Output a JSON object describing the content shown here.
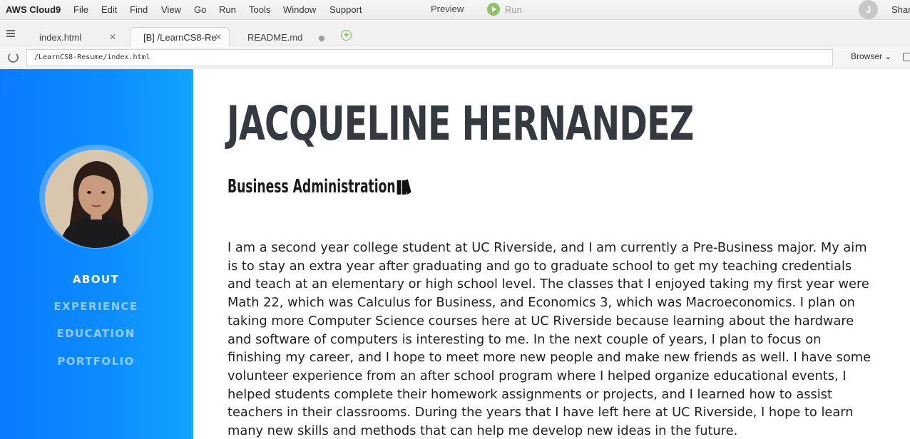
{
  "menubar": {
    "brand": "AWS Cloud9",
    "items": [
      "File",
      "Edit",
      "Find",
      "View",
      "Go",
      "Run",
      "Tools",
      "Window",
      "Support"
    ],
    "preview": "Preview",
    "run": "Run",
    "user_initial": "J",
    "user_name": "Shar"
  },
  "tabs": [
    {
      "label": "index.html",
      "state": "close"
    },
    {
      "label": "[B] /LearnCS8-Re",
      "state": "close"
    },
    {
      "label": "README.md",
      "state": "unsaved"
    }
  ],
  "address_bar": {
    "url": "/LearnCS8-Resume/index.html",
    "browser_select": "Browser"
  },
  "colors": {
    "sidebar_start": "#0a7bff",
    "sidebar_end": "#12a4ff",
    "heading": "#343a40",
    "run_green": "#8fc26a"
  },
  "page": {
    "nav": [
      {
        "label": "ABOUT",
        "active": true
      },
      {
        "label": "EXPERIENCE",
        "active": false
      },
      {
        "label": "EDUCATION",
        "active": false
      },
      {
        "label": "PORTFOLIO",
        "active": false
      }
    ],
    "name": "JACQUELINE HERNANDEZ",
    "subtitle": "Business Administration",
    "subtitle_icon": "books-icon",
    "bio": "I am a second year college student at UC Riverside, and I am currently a Pre-Business major. My aim is to stay an extra year after graduating and go to graduate school to get my teaching credentials and teach at an elementary or high school level. The classes that I enjoyed taking my first year were Math 22, which was Calculus for Business, and Economics 3, which was Macroeconomics. I plan on taking more Computer Science courses here at UC Riverside because learning about the hardware and software of computers is interesting to me. In the next couple of years, I plan to focus on finishing my career, and I hope to meet more new people and make new friends as well. I have some volunteer experience from an after school program where I helped organize educational events, I helped students complete their homework assignments or projects, and I learned how to assist teachers in their classrooms. During the years that I have left here at UC Riverside, I hope to learn many new skills and methods that can help me develop new ideas in the future."
  }
}
